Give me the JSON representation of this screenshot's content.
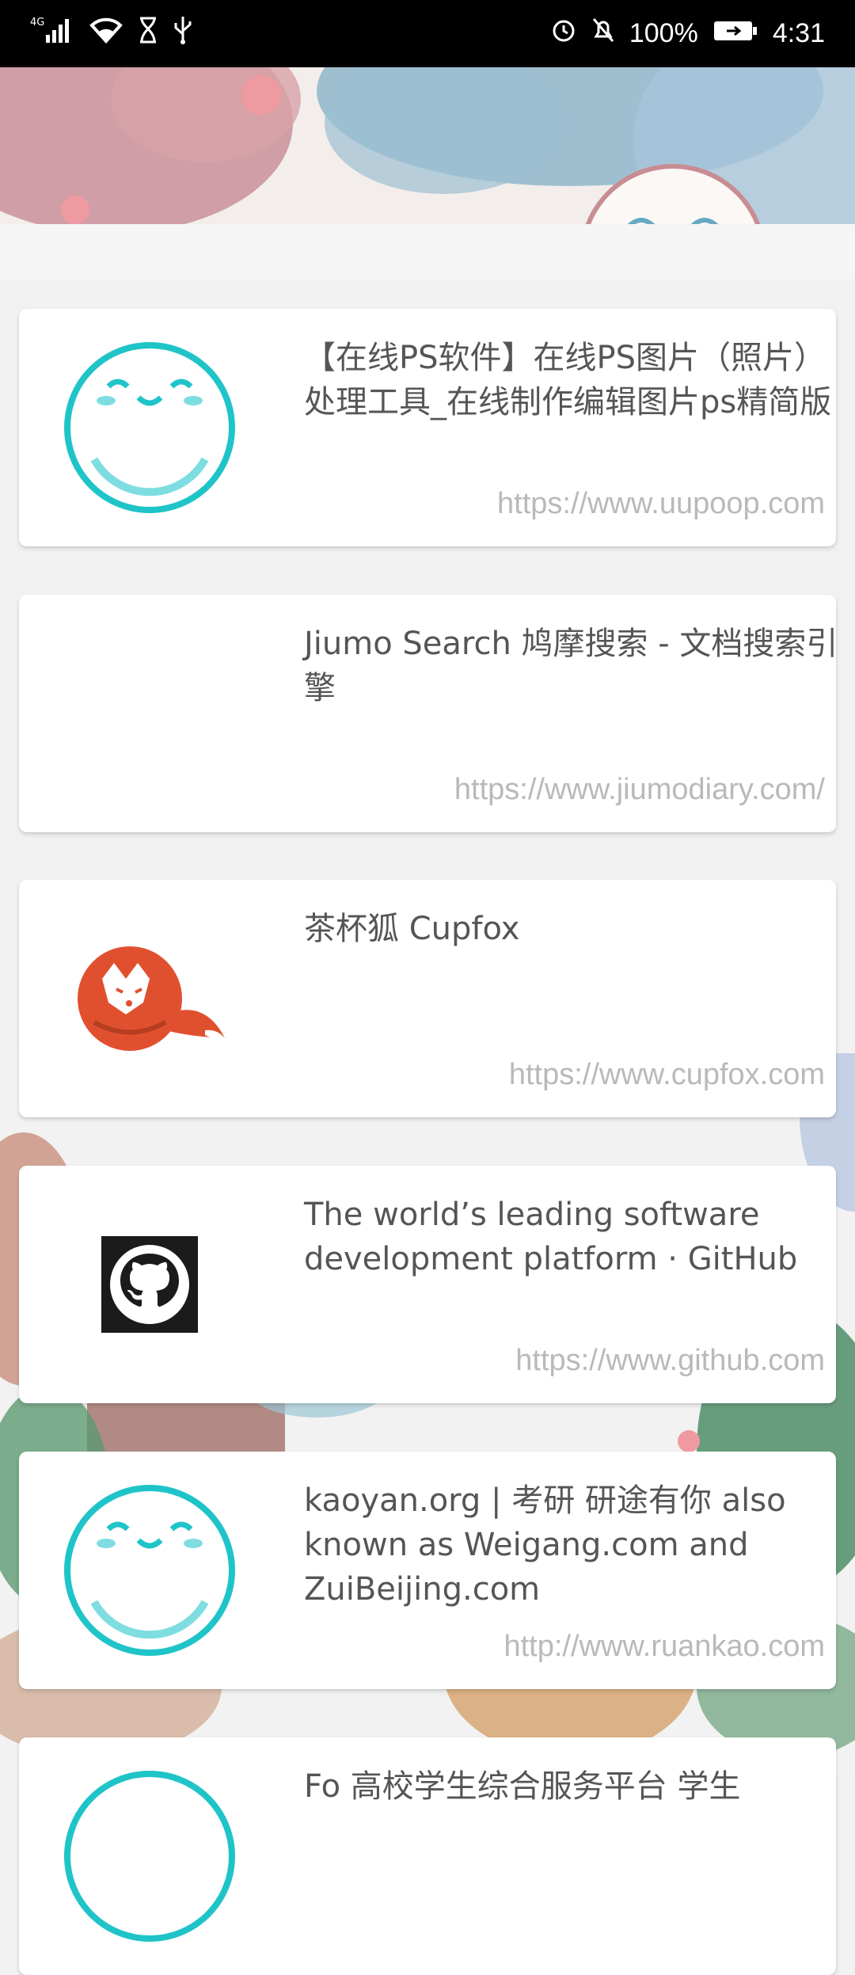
{
  "status_bar": {
    "network": "4G",
    "battery": "100%",
    "time": "4:31"
  },
  "cards": [
    {
      "title": "【在线PS软件】在线PS图片（照片）处理工具_在线制作编辑图片ps精简版",
      "url": "https://www.uupoop.com",
      "icon": "smiley-icon"
    },
    {
      "title": "Jiumo Search 鸠摩搜索 - 文档搜索引擎",
      "url": "https://www.jiumodiary.com/",
      "icon": "none"
    },
    {
      "title": "茶杯狐 Cupfox",
      "url": "https://www.cupfox.com",
      "icon": "cupfox-icon"
    },
    {
      "title": "The world’s leading software development platform · GitHub",
      "url": "https://www.github.com",
      "icon": "github-icon"
    },
    {
      "title": "kaoyan.org | 考研 研途有你 also known as Weigang.com and ZuiBeijing.com",
      "url": "http://www.ruankao.com",
      "icon": "smiley-icon"
    },
    {
      "title": "Fo 高校学生综合服务平台 学生",
      "url": "",
      "icon": "smiley-icon"
    }
  ],
  "colors": {
    "teal": "#1fc4c8",
    "fox": "#e0502f",
    "title_text": "#555555",
    "url_text": "#b9b9b9"
  }
}
